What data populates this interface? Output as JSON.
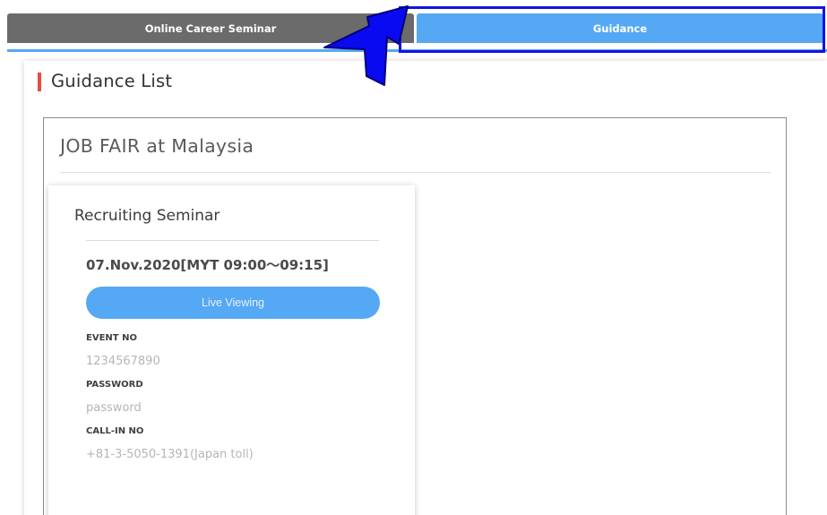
{
  "tabs": [
    {
      "label": "Online Career Seminar",
      "active": false
    },
    {
      "label": "Guidance",
      "active": true
    }
  ],
  "colors": {
    "tab_inactive": "#6b6b6b",
    "tab_active": "#55a8f3",
    "accent_bar": "#e44c3f",
    "annotation": "#1212e8"
  },
  "annotation": {
    "icon": "pointer-arrow-icon"
  },
  "page": {
    "title": "Guidance List"
  },
  "fair": {
    "title": "JOB FAIR at Malaysia"
  },
  "seminar_card": {
    "title": "Recruiting Seminar",
    "date": "07.Nov.2020[MYT 09:00～09:15]",
    "button_label": "Live Viewing",
    "fields": [
      {
        "label": "EVENT NO",
        "value": "1234567890"
      },
      {
        "label": "PASSWORD",
        "value": "password"
      },
      {
        "label": "CALL-IN NO",
        "value": "+81-3-5050-1391(Japan toll)"
      }
    ]
  }
}
